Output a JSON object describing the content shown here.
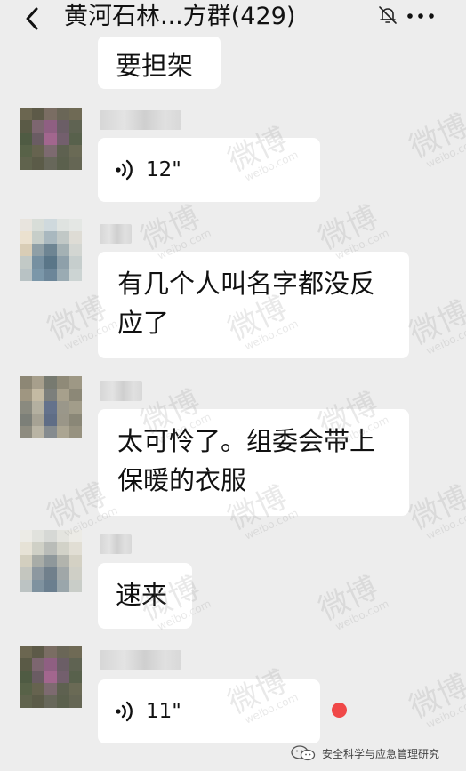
{
  "header": {
    "title": "黄河石林...方群(429)",
    "back_icon": "chevron-left-icon",
    "mute_icon": "bell-off-icon",
    "more_icon": "more-dots-icon"
  },
  "messages": [
    {
      "type": "text",
      "text": "要担架"
    },
    {
      "type": "voice",
      "duration": "12\""
    },
    {
      "type": "text",
      "lines": [
        "有几个人叫名字都没反",
        "应了"
      ]
    },
    {
      "type": "text",
      "lines": [
        "太可怜了。组委会带上",
        "保暖的衣服"
      ]
    },
    {
      "type": "text",
      "text": "速来"
    },
    {
      "type": "voice",
      "duration": "11\"",
      "unread": true
    }
  ],
  "watermark": {
    "text": "微博",
    "subtext": "weibo.com"
  },
  "footer_watermark": {
    "text": "安全科学与应急管理研究",
    "icon": "wechat-icon"
  },
  "colors": {
    "background": "#ededed",
    "bubble": "#ffffff",
    "unread_dot": "#f04848"
  }
}
